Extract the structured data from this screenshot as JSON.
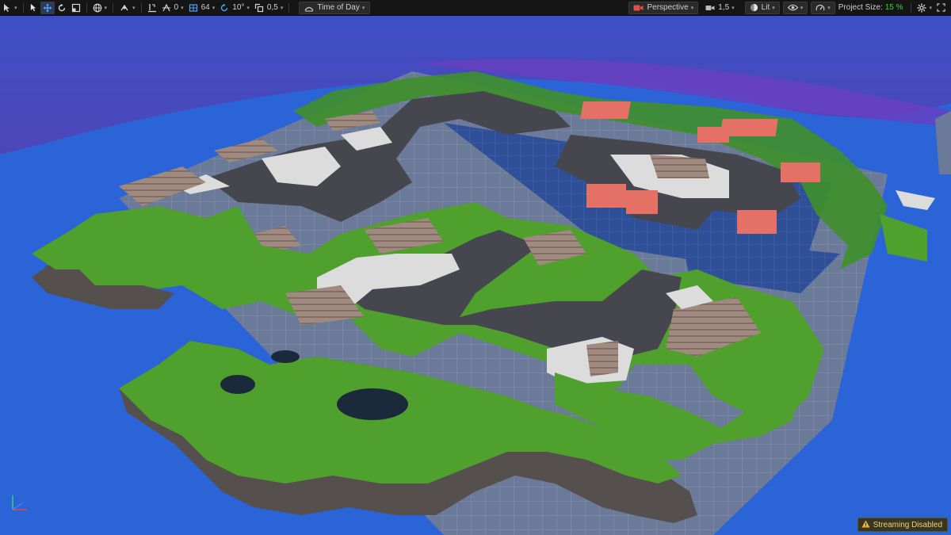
{
  "toolbar": {
    "grid_snap_value": "0",
    "grid_size_value": "64",
    "rotation_snap_value": "10°",
    "scale_snap_value": "0,5",
    "time_of_day_label": "Time of Day",
    "view_mode_label": "Perspective",
    "camera_speed_value": "1,5",
    "lighting_mode_label": "Lit",
    "project_size_label": "Project Size:",
    "project_size_value": "15 %"
  },
  "status": {
    "streaming_label": "Streaming Disabled"
  },
  "colors": {
    "sky": "#3f56c8",
    "water": "#2a64d6",
    "grass": "#4fa02c",
    "road": "#3f3f47",
    "tile": "#6e7b96",
    "accent_red": "#e47066",
    "accent_green": "#3ad13a"
  },
  "icons": [
    "select-icon",
    "move-icon",
    "rotate-icon",
    "scale-icon",
    "world-icon",
    "surface-snap-icon",
    "grid-snap-icon",
    "rotation-snap-icon",
    "scale-snap-icon",
    "camera-icon",
    "eye-icon",
    "gear-icon",
    "warning-icon"
  ]
}
